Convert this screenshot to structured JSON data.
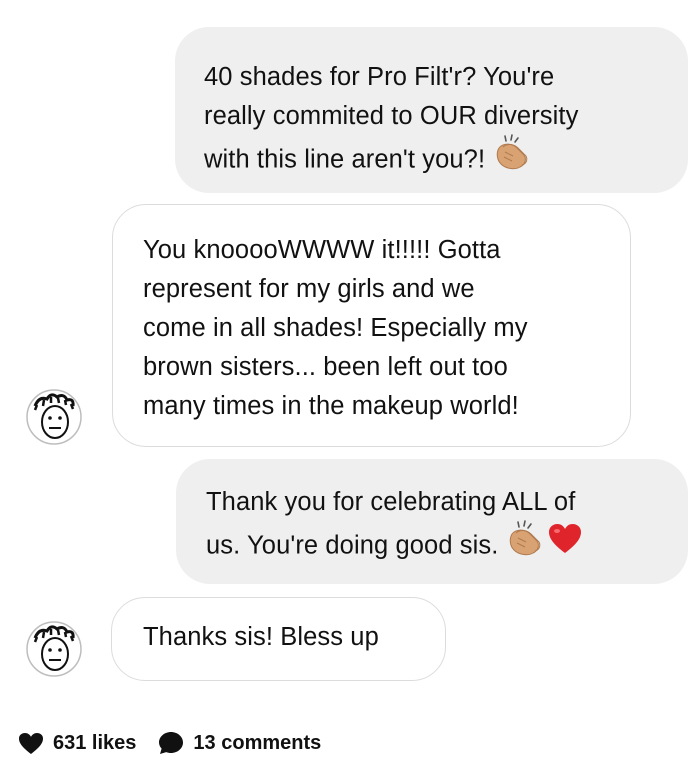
{
  "messages": [
    {
      "direction": "sent",
      "lines": [
        "40 shades for Pro Filt'r? You're",
        "really commited to OUR diversity",
        "with this line aren't you?!"
      ],
      "trailing_emoji": [
        "clapping-hands"
      ]
    },
    {
      "direction": "received",
      "lines": [
        "You knooooWWWW it!!!!! Gotta",
        "represent for my girls and we",
        "come in all shades! Especially my",
        "brown sisters... been left out too",
        "many times in the makeup world!"
      ],
      "trailing_emoji": []
    },
    {
      "direction": "sent",
      "lines": [
        "Thank you for celebrating ALL of",
        "us. You're doing good sis."
      ],
      "trailing_emoji": [
        "clapping-hands",
        "red-heart"
      ]
    },
    {
      "direction": "received",
      "lines": [
        "Thanks sis! Bless up"
      ],
      "trailing_emoji": []
    }
  ],
  "footer": {
    "likes": "631 likes",
    "comments": "13 comments",
    "likes_icon": "heart-icon",
    "comments_icon": "comment-bubble-icon"
  },
  "colors": {
    "sent_bubble": "#efefef",
    "received_border": "#dcdcdc",
    "text": "#111111",
    "heart": "#e0242c",
    "clap": "#f0c08a"
  }
}
